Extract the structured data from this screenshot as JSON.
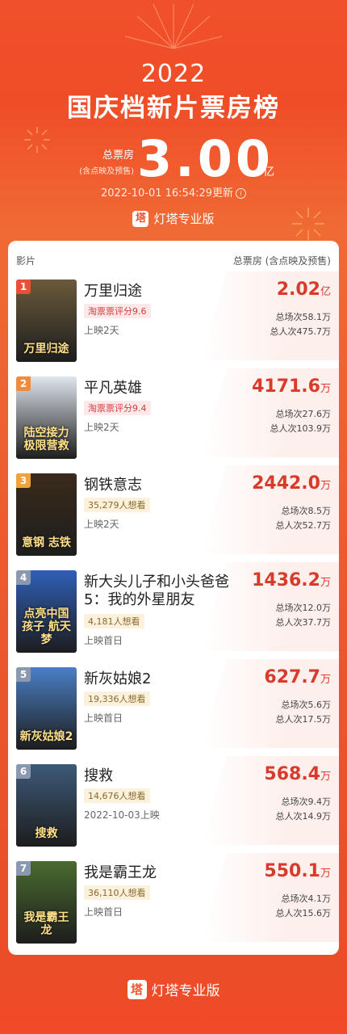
{
  "header": {
    "year": "2022",
    "title": "国庆档新片票房榜",
    "total_label": "总票房",
    "total_sub": "(含点映及预售)",
    "total_value": "3.00",
    "total_unit": "亿",
    "update_time": "2022-10-01 16:54:29更新",
    "info_icon": "i",
    "brand_logo": "塔",
    "brand_name": "灯塔专业版"
  },
  "table": {
    "col_movie": "影片",
    "col_box": "总票房 (含点映及预售)"
  },
  "movies": [
    {
      "rank": "1",
      "name": "万里归途",
      "tag": "淘票票评分9.6",
      "tag_type": "score",
      "release": "上映2天",
      "box": "2.02",
      "unit": "亿",
      "sessions": "总场次58.1万",
      "people": "总人次475.7万",
      "poster_text": "万里归途",
      "poster_color": "#6b5a3a"
    },
    {
      "rank": "2",
      "name": "平凡英雄",
      "tag": "淘票票评分9.4",
      "tag_type": "score",
      "release": "上映2天",
      "box": "4171.6",
      "unit": "万",
      "sessions": "总场次27.6万",
      "people": "总人次103.9万",
      "poster_text": "陆空接力 极限营救",
      "poster_color": "#dfe6ee"
    },
    {
      "rank": "3",
      "name": "钢铁意志",
      "tag": "35,279人想看",
      "tag_type": "want",
      "release": "上映2天",
      "box": "2442.0",
      "unit": "万",
      "sessions": "总场次8.5万",
      "people": "总人次52.7万",
      "poster_text": "意钢 志铁",
      "poster_color": "#3a2a1c"
    },
    {
      "rank": "4",
      "name": "新大头儿子和小头爸爸5：我的外星朋友",
      "tag": "4,181人想看",
      "tag_type": "want",
      "release": "上映首日",
      "box": "1436.2",
      "unit": "万",
      "sessions": "总场次12.0万",
      "people": "总人次37.7万",
      "poster_text": "点亮中国孩子 航天梦",
      "poster_color": "#2f5fb8"
    },
    {
      "rank": "5",
      "name": "新灰姑娘2",
      "tag": "19,336人想看",
      "tag_type": "want",
      "release": "上映首日",
      "box": "627.7",
      "unit": "万",
      "sessions": "总场次5.6万",
      "people": "总人次17.5万",
      "poster_text": "新灰姑娘2",
      "poster_color": "#4a7fc6"
    },
    {
      "rank": "6",
      "name": "搜救",
      "tag": "14,676人想看",
      "tag_type": "want",
      "release": "2022-10-03上映",
      "box": "568.4",
      "unit": "万",
      "sessions": "总场次9.4万",
      "people": "总人次14.9万",
      "poster_text": "搜救",
      "poster_color": "#3d5a78"
    },
    {
      "rank": "7",
      "name": "我是霸王龙",
      "tag": "36,110人想看",
      "tag_type": "want",
      "release": "上映首日",
      "box": "550.1",
      "unit": "万",
      "sessions": "总场次4.1万",
      "people": "总人次15.6万",
      "poster_text": "我是霸王龙",
      "poster_color": "#4a6b2e"
    }
  ],
  "footer": {
    "brand_logo": "塔",
    "brand_name": "灯塔专业版"
  }
}
